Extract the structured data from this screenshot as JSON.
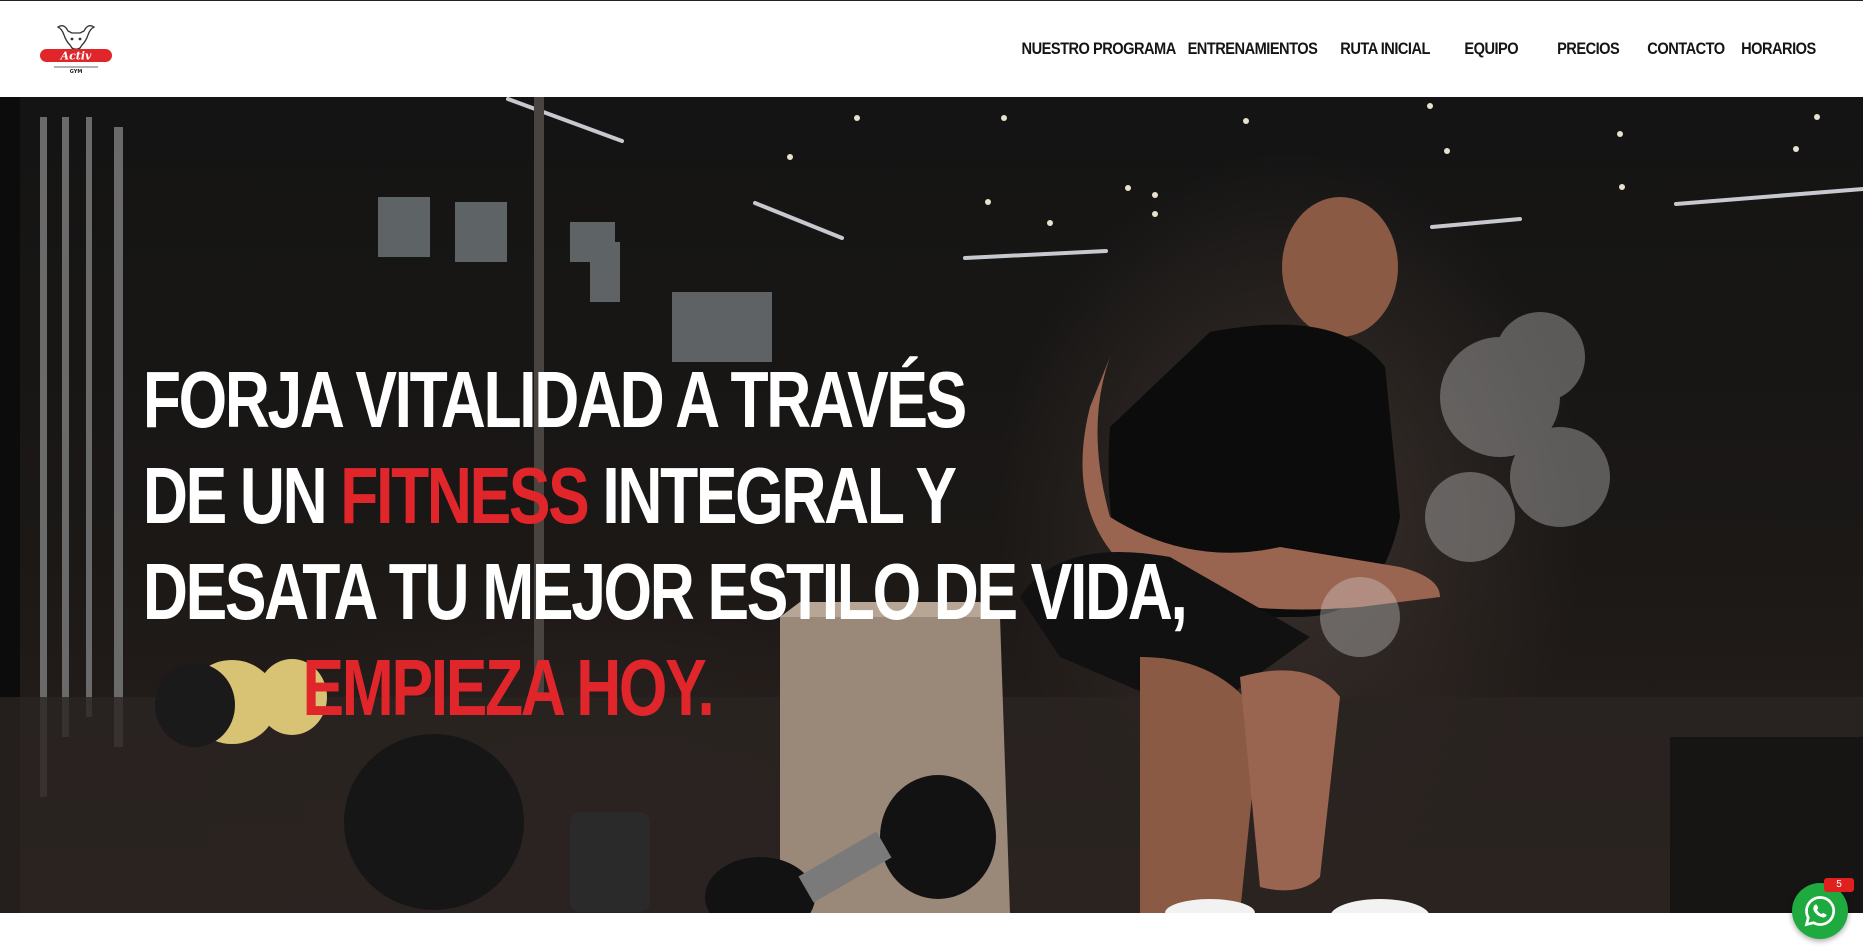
{
  "logo": {
    "name": "Activ GYM",
    "word": "Activ",
    "sub": "GYM"
  },
  "nav": {
    "items": [
      {
        "label": "NUESTRO PROGRAMA"
      },
      {
        "label": "ENTRENAMIENTOS"
      },
      {
        "label": "RUTA INICIAL"
      },
      {
        "label": "EQUIPO"
      },
      {
        "label": "PRECIOS"
      },
      {
        "label": "CONTACTO"
      },
      {
        "label": "HORARIOS"
      }
    ]
  },
  "hero": {
    "line1": "FORJA VITALIDAD A TRAVÉS",
    "line2_a": "DE UN ",
    "line2_accent": "FITNESS",
    "line2_b": " INTEGRAL Y",
    "line3": "DESATA TU MEJOR ESTILO DE VIDA,",
    "line4_accent": "EMPIEZA HOY."
  },
  "whatsapp": {
    "badge": "5",
    "icon": "whatsapp-icon"
  },
  "colors": {
    "accent": "#e1262b",
    "whatsapp": "#1faa3f",
    "text_dark": "#151515"
  }
}
